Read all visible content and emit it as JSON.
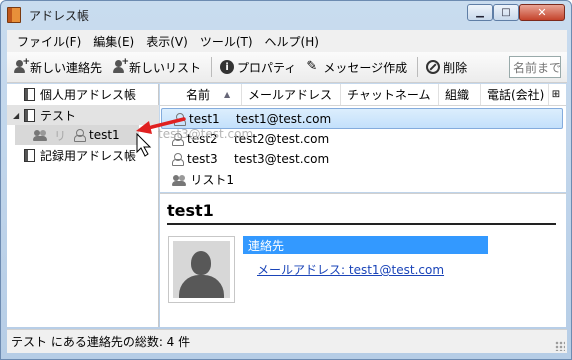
{
  "window": {
    "title": "アドレス帳"
  },
  "menubar": {
    "items": [
      "ファイル(F)",
      "編集(E)",
      "表示(V)",
      "ツール(T)",
      "ヘルプ(H)"
    ]
  },
  "toolbar": {
    "new_contact": "新しい連絡先",
    "new_list": "新しいリスト",
    "properties": "プロパティ",
    "compose": "メッセージ作成",
    "delete": "削除",
    "search_placeholder": "名前まで"
  },
  "sidebar": {
    "personal_book": "個人用アドレス帳",
    "test_book": "テスト",
    "list_item": "リ",
    "dragged_contact": "test1",
    "collected_book": "記録用アドレス帳"
  },
  "columns": [
    "名前",
    "メールアドレス",
    "チャットネーム",
    "組織",
    "電話(会社)"
  ],
  "contacts": [
    {
      "name": "test1",
      "email": "test1@test.com"
    },
    {
      "name": "test2",
      "email": "test2@test.com"
    },
    {
      "name": "test3",
      "email": "test3@test.com"
    },
    {
      "name": "リスト1",
      "email": ""
    }
  ],
  "drag_ghost": "test3@test.com",
  "detail": {
    "name": "test1",
    "section": "連絡先",
    "email_line": "メールアドレス: test1@test.com"
  },
  "status": "テスト にある連絡先の総数: 4 件",
  "colors": {
    "selection": "#c3e0fb",
    "section_header": "#3399ff",
    "link": "#1a44b8",
    "arrow": "#e02020"
  }
}
